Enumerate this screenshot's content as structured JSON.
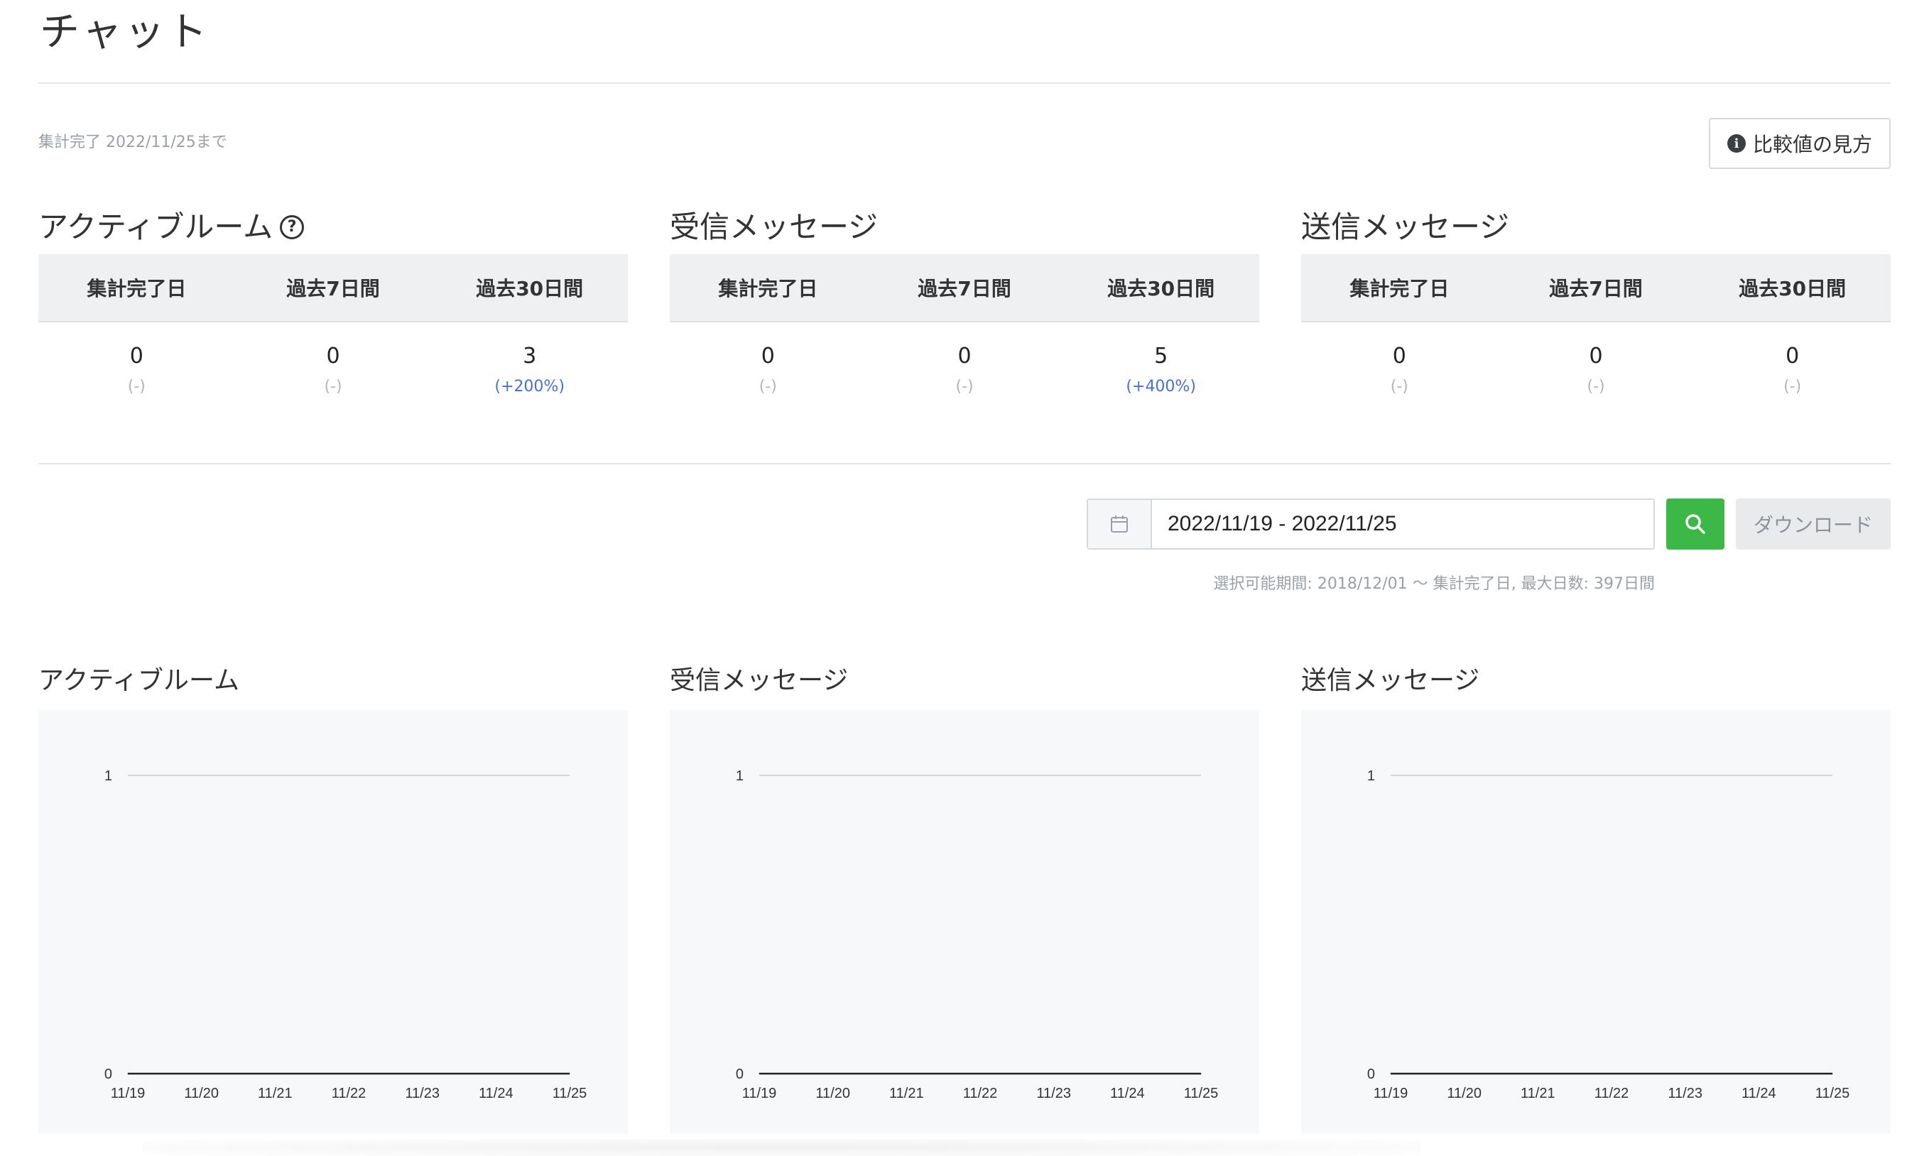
{
  "page": {
    "title": "チャット",
    "status_note": "集計完了 2022/11/25まで",
    "compare_button": "比較値の見方",
    "info_icon": "i",
    "help_icon": "?"
  },
  "summaries": [
    {
      "title": "アクティブルーム",
      "has_help": true,
      "headers": [
        "集計完了日",
        "過去7日間",
        "過去30日間"
      ],
      "values": [
        "0",
        "0",
        "3"
      ],
      "diffs": [
        "(-)",
        "(-)",
        "(+200%)"
      ]
    },
    {
      "title": "受信メッセージ",
      "has_help": false,
      "headers": [
        "集計完了日",
        "過去7日間",
        "過去30日間"
      ],
      "values": [
        "0",
        "0",
        "5"
      ],
      "diffs": [
        "(-)",
        "(-)",
        "(+400%)"
      ]
    },
    {
      "title": "送信メッセージ",
      "has_help": false,
      "headers": [
        "集計完了日",
        "過去7日間",
        "過去30日間"
      ],
      "values": [
        "0",
        "0",
        "0"
      ],
      "diffs": [
        "(-)",
        "(-)",
        "(-)"
      ]
    }
  ],
  "filter": {
    "date_range": "2022/11/19 - 2022/11/25",
    "download_label": "ダウンロード",
    "range_note": "選択可能期間: 2018/12/01 〜 集計完了日, 最大日数: 397日間"
  },
  "colors": {
    "accent_green": "#3cb846",
    "positive_diff": "#4a6fd1",
    "muted": "#b0b5ba"
  },
  "chart_data": [
    {
      "type": "line",
      "title": "アクティブルーム",
      "categories": [
        "11/19",
        "11/20",
        "11/21",
        "11/22",
        "11/23",
        "11/24",
        "11/25"
      ],
      "values": [
        0,
        0,
        0,
        0,
        0,
        0,
        0
      ],
      "ylim": [
        0,
        1
      ],
      "yticks": [
        "0",
        "1"
      ],
      "grid": true
    },
    {
      "type": "line",
      "title": "受信メッセージ",
      "categories": [
        "11/19",
        "11/20",
        "11/21",
        "11/22",
        "11/23",
        "11/24",
        "11/25"
      ],
      "values": [
        0,
        0,
        0,
        0,
        0,
        0,
        0
      ],
      "ylim": [
        0,
        1
      ],
      "yticks": [
        "0",
        "1"
      ],
      "grid": true
    },
    {
      "type": "line",
      "title": "送信メッセージ",
      "categories": [
        "11/19",
        "11/20",
        "11/21",
        "11/22",
        "11/23",
        "11/24",
        "11/25"
      ],
      "values": [
        0,
        0,
        0,
        0,
        0,
        0,
        0
      ],
      "ylim": [
        0,
        1
      ],
      "yticks": [
        "0",
        "1"
      ],
      "grid": true
    }
  ]
}
